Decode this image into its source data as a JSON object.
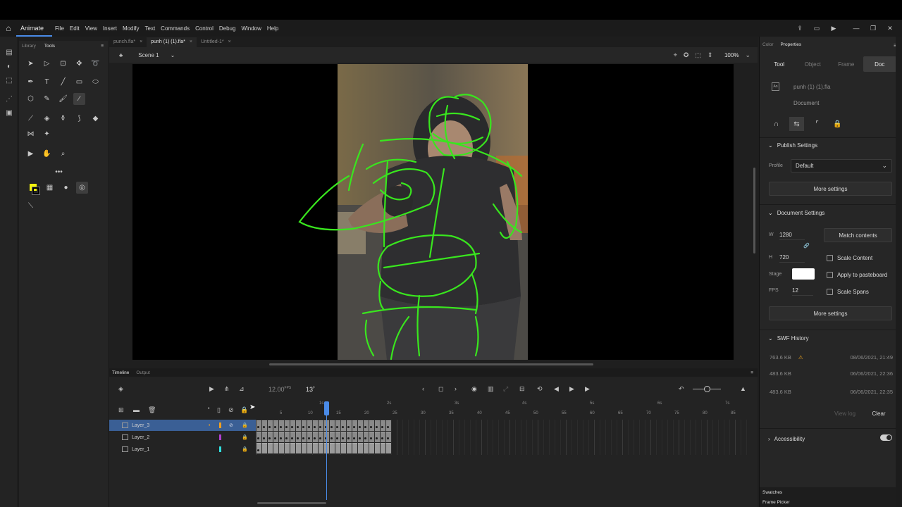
{
  "app": {
    "name": "Animate"
  },
  "menu": [
    "File",
    "Edit",
    "View",
    "Insert",
    "Modify",
    "Text",
    "Commands",
    "Control",
    "Debug",
    "Window",
    "Help"
  ],
  "tools_panel": {
    "tabs": [
      "Library",
      "Tools"
    ]
  },
  "doc_tabs": [
    {
      "label": "punch.fla*"
    },
    {
      "label": "punh (1) (1).fla*"
    },
    {
      "label": "Untitled-1*"
    }
  ],
  "scene": {
    "label": "Scene 1",
    "zoom": "100%"
  },
  "timeline": {
    "tabs": [
      "Timeline",
      "Output"
    ],
    "fps": "12.00",
    "fps_unit": "FPS",
    "current_frame": "13",
    "frame_unit": "F",
    "ruler_seconds": [
      "1s",
      "2s",
      "3s",
      "4s",
      "5s",
      "6s",
      "7s"
    ],
    "ruler_numbers": [
      "5",
      "10",
      "15",
      "20",
      "25",
      "30",
      "35",
      "40",
      "45",
      "50",
      "55",
      "60",
      "65",
      "70",
      "75",
      "80",
      "85"
    ],
    "layers": [
      {
        "name": "Layer_3",
        "color": "#f0a020",
        "selected": true
      },
      {
        "name": "Layer_2",
        "color": "#b040d0",
        "selected": false
      },
      {
        "name": "Layer_1",
        "color": "#30e0e0",
        "selected": false
      }
    ]
  },
  "right_panel": {
    "tabs": [
      "Color",
      "Properties"
    ],
    "prop_tabs": [
      "Tool",
      "Object",
      "Frame",
      "Doc"
    ],
    "doc_name": "punh (1) (1).fla",
    "doc_type": "Document",
    "publish": {
      "title": "Publish Settings",
      "profile_label": "Profile",
      "profile_value": "Default",
      "more_label": "More settings"
    },
    "doc_settings": {
      "title": "Document Settings",
      "w_label": "W",
      "w_value": "1280",
      "h_label": "H",
      "h_value": "720",
      "match_label": "Match contents",
      "stage_label": "Stage",
      "fps_label": "FPS",
      "fps_value": "12",
      "scale_content": "Scale Content",
      "apply_pasteboard": "Apply to pasteboard",
      "scale_spans": "Scale Spans",
      "more_label": "More settings"
    },
    "swf": {
      "title": "SWF History",
      "entries": [
        {
          "size": "763.6 KB",
          "date": "08/06/2021, 21:49",
          "warn": true
        },
        {
          "size": "483.6 KB",
          "date": "06/06/2021, 22:36",
          "warn": false
        },
        {
          "size": "483.6 KB",
          "date": "06/06/2021, 22:35",
          "warn": false
        }
      ],
      "view_log": "View log",
      "clear": "Clear"
    },
    "accessibility": "Accessibility",
    "bottom_tabs": [
      "Swatches",
      "Frame Picker"
    ]
  },
  "colors": {
    "accent": "#4a8be8",
    "fill_color": "#f5f50a",
    "sketch": "#39e61e",
    "selected_layer": "#3a5f95"
  }
}
